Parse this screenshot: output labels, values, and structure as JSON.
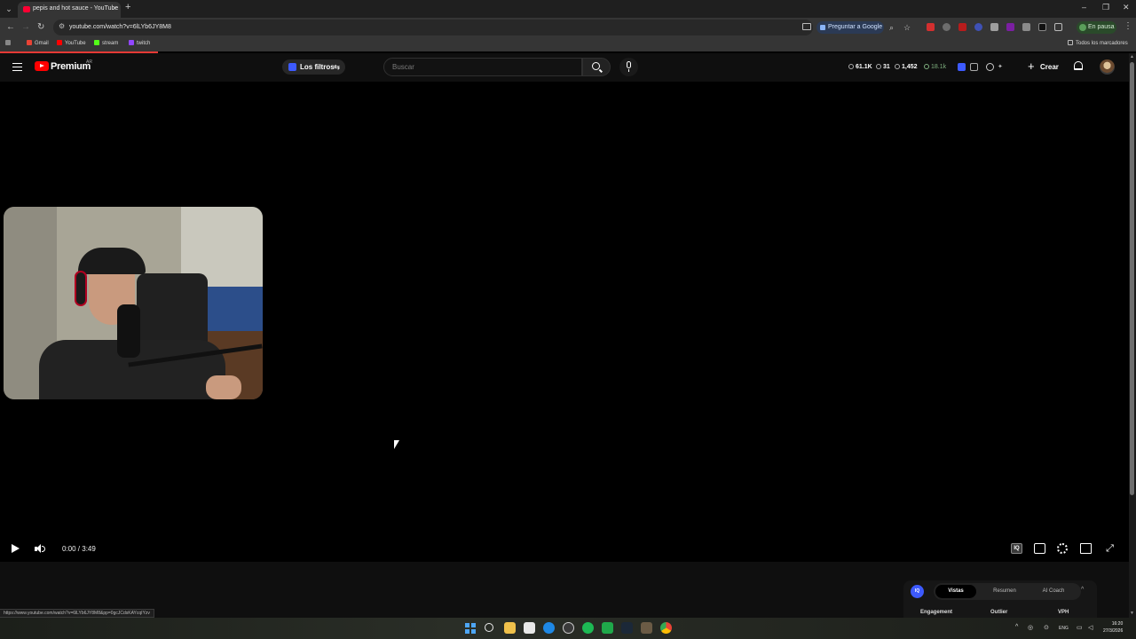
{
  "browser": {
    "tab_title": "pepis and hot sauce - YouTube",
    "url": "youtube.com/watch?v=6lLYb6JY8M8",
    "ask_google_label": "Preguntar a Google",
    "profile_status": "En pausa",
    "bookmarks": [
      "Gmail",
      "YouTube",
      "stream",
      "twitch"
    ],
    "all_bookmarks_label": "Todos los marcadores"
  },
  "youtube": {
    "logo_text": "Premium",
    "region": "AR",
    "filters_label": "Los filtros",
    "search_placeholder": "Buscar",
    "stats": {
      "views": "61.1K",
      "comments": "31",
      "watching": "1,452",
      "subs": "18.1k"
    },
    "create_label": "Crear"
  },
  "player": {
    "time": "0:00 / 3:49",
    "iq_label": "IQ"
  },
  "status_bar_url": "https://www.youtube.com/watch?v=6lLYb6JY8M8&pp=0gcJCdsKAYcqIYzv",
  "iq_panel": {
    "logo": "IQ",
    "tabs": [
      "Vistas",
      "Resumen",
      "AI Coach"
    ],
    "active_tab": "Vistas",
    "metrics": [
      "Engagement",
      "Outlier",
      "VPH"
    ]
  },
  "taskbar": {
    "language": "ENG",
    "time": "16:20",
    "date": "27/3/2026"
  }
}
